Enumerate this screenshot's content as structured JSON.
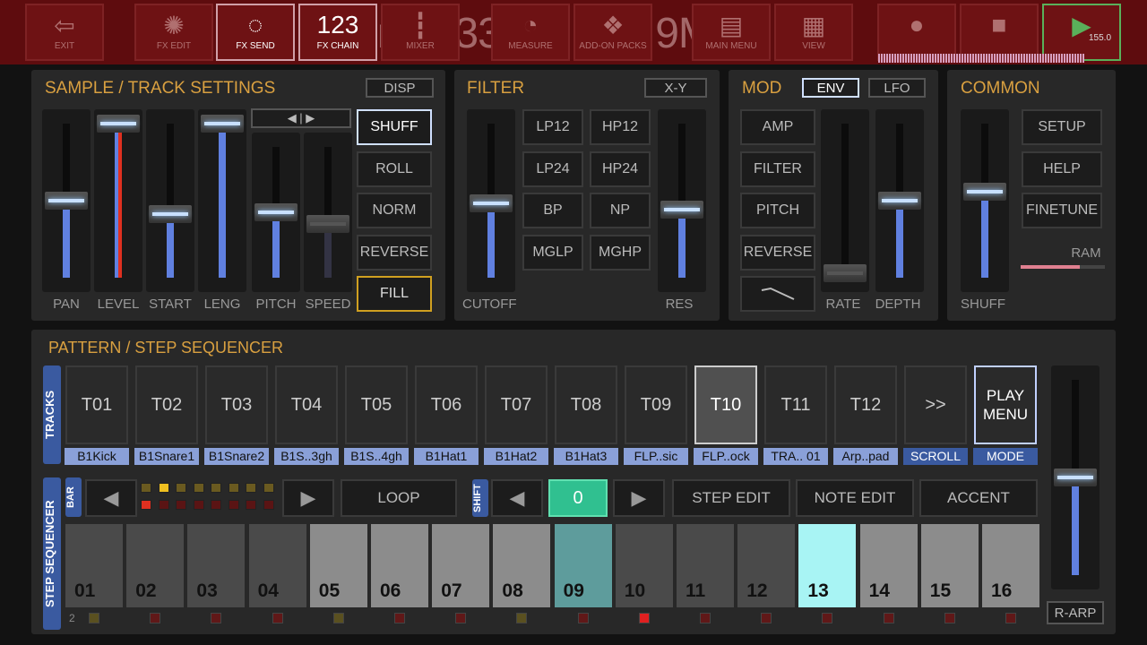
{
  "toolbar": {
    "buttons": [
      {
        "label": "EXIT",
        "icon": "exit-icon",
        "glyph": "⇦"
      },
      {
        "label": "FX EDIT",
        "icon": "fx-edit-icon",
        "glyph": "✺"
      },
      {
        "label": "FX SEND",
        "icon": "fx-send-icon",
        "glyph": "◌"
      },
      {
        "label": "FX CHAIN",
        "icon": "fx-chain-icon",
        "glyph": "123"
      },
      {
        "label": "MIXER",
        "icon": "mixer-icon",
        "glyph": "┇"
      },
      {
        "label": "MEASURE",
        "icon": "measure-icon",
        "glyph": "◔"
      },
      {
        "label": "ADD-ON PACKS",
        "icon": "addon-icon",
        "glyph": "❖"
      },
      {
        "label": "MAIN MENU",
        "icon": "main-menu-icon",
        "glyph": "▤"
      },
      {
        "label": "VIEW",
        "icon": "view-icon",
        "glyph": "▦"
      }
    ],
    "record_icon": "●",
    "stop_icon": "■",
    "play_icon": "▶",
    "tempo": "155.0",
    "overlay": "3min 33sec / 35.9MB"
  },
  "sample": {
    "title": "SAMPLE / TRACK SETTINGS",
    "disp": "DISP",
    "arrows": "◀ | ▶",
    "faders": [
      {
        "label": "PAN",
        "value": 0.5
      },
      {
        "label": "LEVEL",
        "value": 1.0
      },
      {
        "label": "START",
        "value": 0.41
      },
      {
        "label": "LENG",
        "value": 1.0
      },
      {
        "label": "PITCH",
        "value": 0.5
      },
      {
        "label": "SPEED",
        "value": 0.41
      }
    ],
    "buttons": [
      "SHUFF",
      "ROLL",
      "NORM",
      "REVERSE",
      "FILL"
    ]
  },
  "filter": {
    "title": "FILTER",
    "xy": "X-Y",
    "cutoff": {
      "label": "CUTOFF",
      "value": 0.48
    },
    "res": {
      "label": "RES",
      "value": 0.44
    },
    "types": [
      "LP12",
      "HP12",
      "LP24",
      "HP24",
      "BP",
      "NP",
      "MGLP",
      "MGHP"
    ]
  },
  "mod": {
    "title": "MOD",
    "env": "ENV",
    "lfo": "LFO",
    "targets": [
      "AMP",
      "FILTER",
      "PITCH",
      "REVERSE"
    ],
    "shape_icon": "ramp-icon",
    "rate": {
      "label": "RATE",
      "value": 0.03
    },
    "depth": {
      "label": "DEPTH",
      "value": 0.5
    }
  },
  "common": {
    "title": "COMMON",
    "shuff": {
      "label": "SHUFF",
      "value": 0.56
    },
    "buttons": [
      "SETUP",
      "HELP",
      "FINETUNE"
    ],
    "ram": "RAM",
    "ram_usage": 0.7
  },
  "pattern": {
    "title": "PATTERN / STEP SEQUENCER",
    "tracks_label": "TRACKS",
    "tracks": [
      {
        "n": "T01",
        "s": "B1Kick"
      },
      {
        "n": "T02",
        "s": "B1Snare1"
      },
      {
        "n": "T03",
        "s": "B1Snare2"
      },
      {
        "n": "T04",
        "s": "B1S..3gh"
      },
      {
        "n": "T05",
        "s": "B1S..4gh"
      },
      {
        "n": "T06",
        "s": "B1Hat1"
      },
      {
        "n": "T07",
        "s": "B1Hat2"
      },
      {
        "n": "T08",
        "s": "B1Hat3"
      },
      {
        "n": "T09",
        "s": "FLP..sic"
      },
      {
        "n": "T10",
        "s": "FLP..ock"
      },
      {
        "n": "T11",
        "s": "TRA.. 01"
      },
      {
        "n": "T12",
        "s": "Arp..pad"
      },
      {
        "n": ">>",
        "s": "SCROLL"
      },
      {
        "n": "PLAY MENU",
        "s": "MODE"
      }
    ],
    "selected_track": "T10",
    "seq_label": "STEP SEQUENCER",
    "bar": "BAR",
    "shift": "SHIFT",
    "loop": "LOOP",
    "step_value": "0",
    "step_edit": "STEP EDIT",
    "note_edit": "NOTE EDIT",
    "accent": "ACCENT",
    "r_arp": "R-ARP",
    "page": "2",
    "master_value": 0.5,
    "steps": [
      "01",
      "02",
      "03",
      "04",
      "05",
      "06",
      "07",
      "08",
      "09",
      "10",
      "11",
      "12",
      "13",
      "14",
      "15",
      "16"
    ],
    "step_colors": [
      "#4a4a4a",
      "#4a4a4a",
      "#4a4a4a",
      "#4a4a4a",
      "#8c8c8c",
      "#8c8c8c",
      "#8c8c8c",
      "#8c8c8c",
      "#5e9c9c",
      "#4a4a4a",
      "#4a4a4a",
      "#4a4a4a",
      "#a8f4f4",
      "#8c8c8c",
      "#8c8c8c",
      "#8c8c8c"
    ],
    "step_leds": [
      "#5a5020",
      "#601818",
      "#601818",
      "#601818",
      "#5a5020",
      "#601818",
      "#601818",
      "#5a5020",
      "#601818",
      "#e02020",
      "#601818",
      "#601818",
      "#601818",
      "#601818",
      "#601818",
      "#601818"
    ]
  }
}
